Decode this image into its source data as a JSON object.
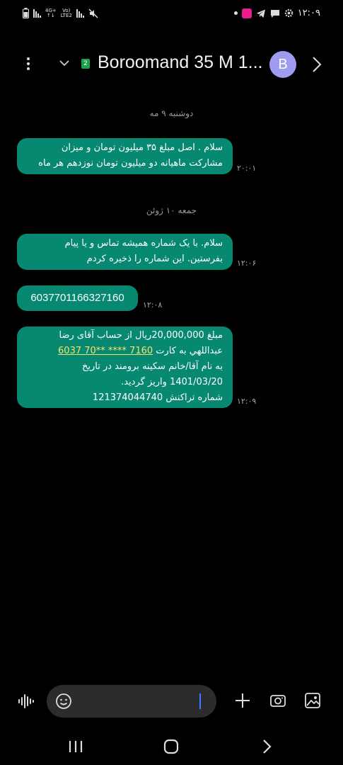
{
  "status_bar": {
    "network_label_top": "4G+",
    "network_label_mid": "Vo)",
    "network_label_bot": "LTE2",
    "time": "۱۲:۰۹",
    "icons": [
      "battery-icon",
      "signal-icon",
      "signal-icon",
      "mute-icon",
      "dot-icon",
      "app-notification-icon",
      "telegram-icon",
      "chat-notification-icon",
      "settings-icon"
    ]
  },
  "header": {
    "sim_number": "2",
    "contact_name": "Boroomand 35 M 1...",
    "avatar_letter": "B"
  },
  "thread": [
    {
      "type": "date",
      "text": "دوشنبه ۹ مه"
    },
    {
      "type": "message",
      "lines": [
        "سلام . اصل مبلغ ۳۵ میلیون تومان و میزان",
        "مشارکت ماهیانه دو میلیون تومان نوزدهم هر ماه"
      ],
      "time": "۲۰:۰۱"
    },
    {
      "type": "date",
      "text": "جمعه ۱۰ ژوئن"
    },
    {
      "type": "message",
      "lines": [
        "سلام. با یک شماره همیشه تماس و یا پیام",
        "بفرستین. این شماره را ذخیره کردم"
      ],
      "time": "۱۲:۰۶"
    },
    {
      "type": "message",
      "lines": [
        "6037701166327160"
      ],
      "time": "۱۲:۰۸"
    },
    {
      "type": "message",
      "time": "۱۲:۰۹",
      "line1": "مبلغ 20,000,000ریال از حساب آقای رضا",
      "line2_prefix": "عبداللهي به کارت ",
      "card_link": "6037 70** **** 7160",
      "line3": "به نام آقا/خانم سکینه برومند در تاریخ",
      "line4": "1401/03/20 واريز گرديد.",
      "line5": "شماره تراکنش 121374044740"
    }
  ],
  "composer": {
    "placeholder": ""
  }
}
